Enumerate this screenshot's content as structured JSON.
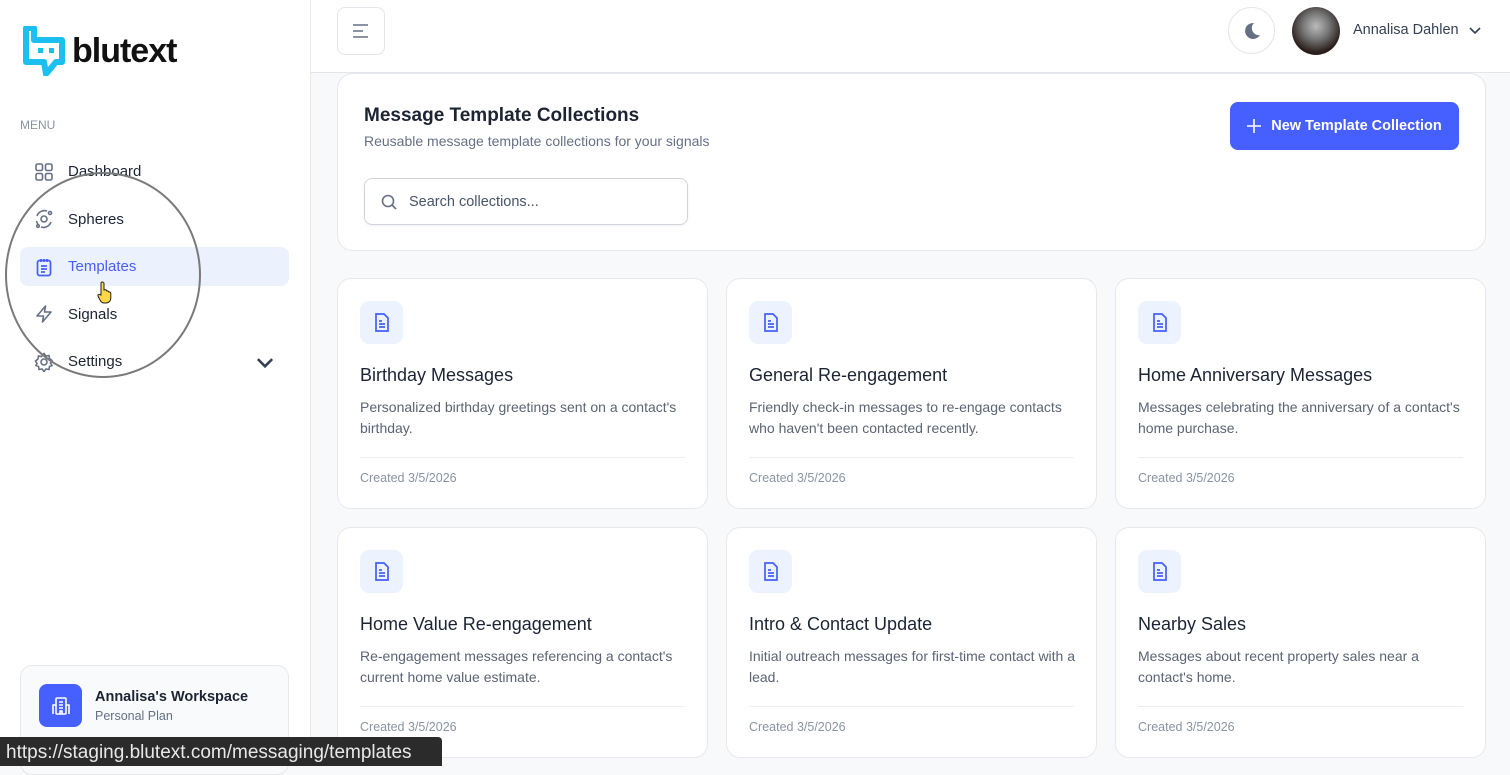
{
  "brand": {
    "name": "blutext",
    "color": "#1cc0f0"
  },
  "sidebar": {
    "menu_label": "MENU",
    "items": [
      {
        "label": "Dashboard",
        "icon": "grid-icon"
      },
      {
        "label": "Spheres",
        "icon": "orbit-icon"
      },
      {
        "label": "Templates",
        "icon": "clipboard-icon",
        "active": true
      },
      {
        "label": "Signals",
        "icon": "lightning-icon"
      },
      {
        "label": "Settings",
        "icon": "gear-icon"
      }
    ],
    "workspace": {
      "name": "Annalisa's Workspace",
      "plan": "Personal Plan"
    }
  },
  "header": {
    "user_name": "Annalisa Dahlen"
  },
  "main": {
    "title": "Message Template Collections",
    "subtitle": "Reusable message template collections for your signals",
    "search_placeholder": "Search collections...",
    "new_button": "New Template Collection",
    "accent": "#465fff",
    "cards": [
      {
        "title": "Birthday Messages",
        "desc": "Personalized birthday greetings sent on a contact's birthday.",
        "created": "Created 3/5/2026"
      },
      {
        "title": "General Re-engagement",
        "desc": "Friendly check-in messages to re-engage contacts who haven't been contacted recently.",
        "created": "Created 3/5/2026"
      },
      {
        "title": "Home Anniversary Messages",
        "desc": "Messages celebrating the anniversary of a contact's home purchase.",
        "created": "Created 3/5/2026"
      },
      {
        "title": "Home Value Re-engagement",
        "desc": "Re-engagement messages referencing a contact's current home value estimate.",
        "created": "Created 3/5/2026"
      },
      {
        "title": "Intro & Contact Update",
        "desc": "Initial outreach messages for first-time contact with a lead.",
        "created": "Created 3/5/2026"
      },
      {
        "title": "Nearby Sales",
        "desc": "Messages about recent property sales near a contact's home.",
        "created": "Created 3/5/2026"
      }
    ]
  },
  "status_url": "https://staging.blutext.com/messaging/templates"
}
